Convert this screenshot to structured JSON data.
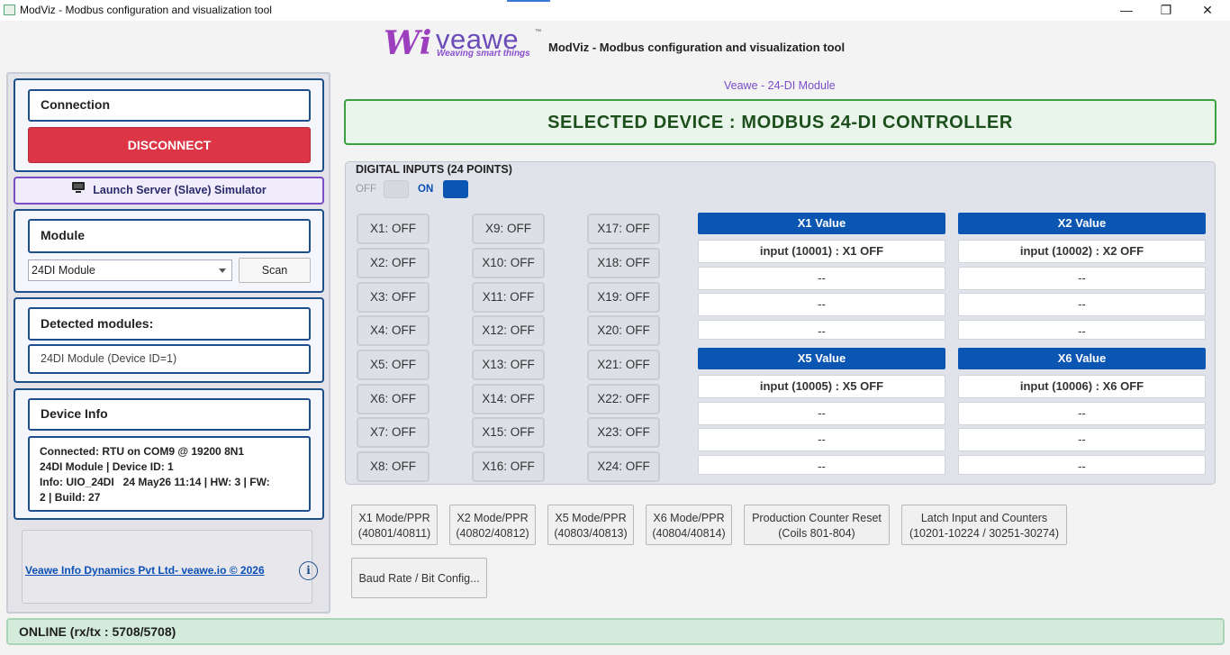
{
  "window": {
    "title": "ModViz - Modbus configuration and visualization tool",
    "minimize_glyph": "—",
    "maximize_glyph": "❐",
    "close_glyph": "✕"
  },
  "header": {
    "logo_mark": "Wi",
    "logo_brand": "veawe",
    "logo_tagline": "Weaving smart things",
    "logo_tm": "™",
    "app_title": "ModViz - Modbus configuration and visualization tool",
    "subtitle": "Veawe - 24-DI Module"
  },
  "sidebar": {
    "connection": {
      "title": "Connection",
      "disconnect_label": "DISCONNECT"
    },
    "simulator_label": "Launch Server (Slave) Simulator",
    "module": {
      "title": "Module",
      "selected": "24DI Module",
      "scan_label": "Scan"
    },
    "detected": {
      "title": "Detected modules:",
      "items": [
        "24DI Module (Device ID=1)"
      ]
    },
    "device_info": {
      "title": "Device Info",
      "line1": "Connected: RTU on COM9 @ 19200 8N1",
      "line2": "24DI Module | Device ID: 1",
      "line3": "Info: UIO_24DI   24 May26 11:14 | HW: 3 | FW:",
      "line4": "2 | Build: 27"
    },
    "footer_link": "Veawe Info Dynamics Pvt Ltd- veawe.io © 2026",
    "info_glyph": "i"
  },
  "main": {
    "selected_device": "SELECTED DEVICE : MODBUS 24-DI CONTROLLER",
    "panel_title": "DIGITAL INPUTS (24 POINTS)",
    "legend_off": "OFF",
    "legend_on": "ON",
    "inputs": [
      "X1: OFF",
      "X2: OFF",
      "X3: OFF",
      "X4: OFF",
      "X5: OFF",
      "X6: OFF",
      "X7: OFF",
      "X8: OFF",
      "X9: OFF",
      "X10: OFF",
      "X11: OFF",
      "X12: OFF",
      "X13: OFF",
      "X14: OFF",
      "X15: OFF",
      "X16: OFF",
      "X17: OFF",
      "X18: OFF",
      "X19: OFF",
      "X20: OFF",
      "X21: OFF",
      "X22: OFF",
      "X23: OFF",
      "X24: OFF"
    ],
    "value_panels": [
      {
        "header": "X1 Value",
        "rows": [
          "input (10001) : X1 OFF",
          "--",
          "--",
          "--"
        ]
      },
      {
        "header": "X2 Value",
        "rows": [
          "input (10002) : X2 OFF",
          "--",
          "--",
          "--"
        ]
      },
      {
        "header": "X5 Value",
        "rows": [
          "input (10005) : X5 OFF",
          "--",
          "--",
          "--"
        ]
      },
      {
        "header": "X6 Value",
        "rows": [
          "input (10006) : X6 OFF",
          "--",
          "--",
          "--"
        ]
      }
    ],
    "actions": [
      {
        "line1": "X1 Mode/PPR",
        "line2": "(40801/40811)"
      },
      {
        "line1": "X2 Mode/PPR",
        "line2": "(40802/40812)"
      },
      {
        "line1": "X5 Mode/PPR",
        "line2": "(40803/40813)"
      },
      {
        "line1": "X6 Mode/PPR",
        "line2": "(40804/40814)"
      },
      {
        "line1": "Production Counter Reset",
        "line2": "(Coils 801-804)"
      },
      {
        "line1": "Latch Input and Counters",
        "line2": "(10201-10224 / 30251-30274)"
      }
    ],
    "baud_label": "Baud Rate / Bit Config..."
  },
  "status": {
    "text": "ONLINE (rx/tx : 5708/5708)"
  },
  "colors": {
    "accent_blue": "#0b56b3",
    "disconnect_red": "#dc3545",
    "selected_green": "#3ba03f",
    "status_green": "#d2ebdb",
    "brand_purple": "#7a4cc8"
  }
}
